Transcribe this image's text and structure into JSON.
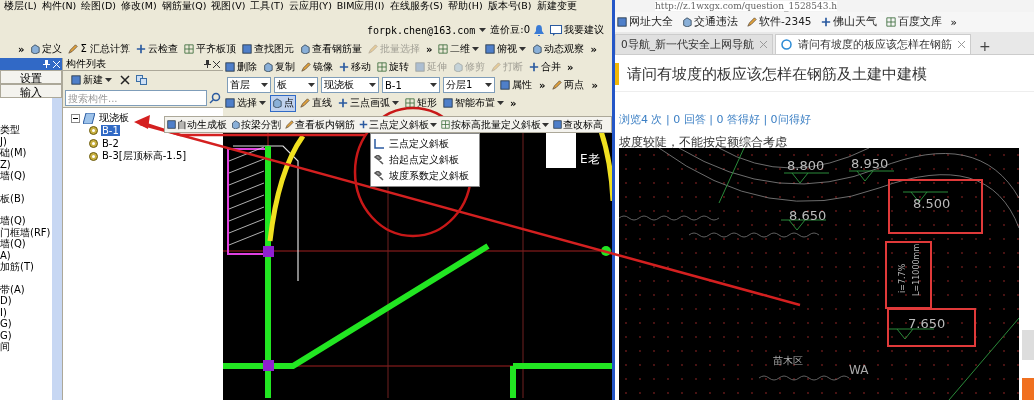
{
  "cad_app": {
    "menu": [
      "楼层(L)",
      "构件(N)",
      "绘图(D)",
      "修改(M)",
      "钢筋量(Q)",
      "视图(V)",
      "工具(T)",
      "云应用(Y)",
      "BIM应用(I)",
      "在线服务(S)",
      "帮助(H)",
      "版本号(B)",
      "新建变更"
    ],
    "account": {
      "email": "forpk.chen@163.com",
      "beans": "造价豆:0",
      "suggest": "我要建议"
    },
    "main_toolbar": [
      {
        "kind": "more",
        "label": "»"
      },
      {
        "kind": "button",
        "label": "定义",
        "disabled": false
      },
      {
        "kind": "button",
        "glyph": "Σ",
        "label": "汇总计算",
        "disabled": false
      },
      {
        "kind": "button",
        "label": "云检查",
        "disabled": false
      },
      {
        "kind": "button",
        "label": "平齐板顶",
        "disabled": false
      },
      {
        "kind": "button",
        "label": "查找图元",
        "disabled": false
      },
      {
        "kind": "button",
        "label": "查看钢筋量",
        "disabled": false
      },
      {
        "kind": "button",
        "label": "批量选择",
        "disabled": true
      },
      {
        "kind": "more",
        "label": "»"
      },
      {
        "kind": "dropdown",
        "label": "二维",
        "disabled": false
      },
      {
        "kind": "dropdown",
        "label": "俯视",
        "disabled": false
      },
      {
        "kind": "button",
        "label": "动态观察",
        "disabled": false
      },
      {
        "kind": "more",
        "label": "»"
      }
    ],
    "nav_panel": {
      "items": [
        "设置",
        "输入"
      ],
      "groups": [
        [
          "类型",
          "J)",
          "础(M)",
          "Z)",
          "墙(Q)"
        ],
        [
          "板(B)"
        ],
        [
          "墙(Q)",
          "门框墙(RF)",
          "墙(Q)",
          "A)",
          "加筋(T)"
        ],
        [
          "带(A)",
          "D)",
          "I)",
          "G)",
          "G)",
          "间"
        ]
      ]
    },
    "component_list": {
      "title": "构件列表",
      "new_button": "新建",
      "search_placeholder": "搜索构件...",
      "tree": [
        {
          "label": "现浇板",
          "expanded": true,
          "selected": false,
          "children": [
            {
              "label": "B-1",
              "selected": true
            },
            {
              "label": "B-2",
              "selected": false
            },
            {
              "label": "B-3[层顶标高-1.5]",
              "selected": false
            }
          ]
        }
      ]
    },
    "edit_toolbar": [
      {
        "kind": "button",
        "label": "删除",
        "disabled": false
      },
      {
        "kind": "button",
        "label": "复制",
        "disabled": false
      },
      {
        "kind": "button",
        "label": "镜像",
        "disabled": false
      },
      {
        "kind": "button",
        "label": "移动",
        "disabled": false
      },
      {
        "kind": "button",
        "label": "旋转",
        "disabled": false
      },
      {
        "kind": "button",
        "label": "延伸",
        "disabled": true
      },
      {
        "kind": "button",
        "label": "修剪",
        "disabled": true
      },
      {
        "kind": "button",
        "label": "打断",
        "disabled": true
      },
      {
        "kind": "button",
        "label": "合并",
        "disabled": false
      },
      {
        "kind": "more",
        "label": "»"
      }
    ],
    "selector_bar": [
      {
        "kind": "combo",
        "label": "首层"
      },
      {
        "kind": "combo",
        "label": "板"
      },
      {
        "kind": "combo",
        "label": "现浇板"
      },
      {
        "kind": "combo",
        "label": "B-1"
      },
      {
        "kind": "combo",
        "label": "分层1"
      },
      {
        "kind": "button",
        "label": "属性"
      },
      {
        "kind": "more",
        "label": "»"
      },
      {
        "kind": "button",
        "label": "两点"
      },
      {
        "kind": "more",
        "label": "»"
      }
    ],
    "draw_toolbar": [
      {
        "kind": "dropdown",
        "label": "选择",
        "pressed": false
      },
      {
        "kind": "button",
        "label": "点",
        "pressed": true
      },
      {
        "kind": "button",
        "label": "直线",
        "pressed": false
      },
      {
        "kind": "dropdown",
        "label": "三点画弧",
        "pressed": false
      },
      {
        "kind": "button",
        "label": "矩形",
        "pressed": false
      },
      {
        "kind": "dropdown",
        "label": "智能布置",
        "pressed": false
      },
      {
        "kind": "more",
        "label": "»"
      }
    ],
    "slab_toolbar": [
      {
        "kind": "button",
        "label": "自动生成板"
      },
      {
        "kind": "button",
        "label": "按梁分割"
      },
      {
        "kind": "button",
        "label": "查看板内钢筋"
      },
      {
        "kind": "dropdown",
        "label": "三点定义斜板"
      },
      {
        "kind": "dropdown",
        "label": "按标高批量定义斜板"
      },
      {
        "kind": "button",
        "label": "查改标高"
      }
    ],
    "slope_menu": [
      "三点定义斜板",
      "抬起点定义斜板",
      "坡度系数定义斜板"
    ],
    "canvas": {
      "label": "E老"
    }
  },
  "browser": {
    "address": "http://z.1wxgx.com/question_1528543.h",
    "bookmarks": [
      "网址大全",
      "交通违法",
      "软件-2345",
      "佛山天气",
      "百度文库"
    ],
    "bookmarks_more": "»",
    "tabs": [
      {
        "label": "0导航_新一代安全上网导航",
        "selected": false
      },
      {
        "label": "请问有坡度的板应该怎样在钢筋",
        "selected": true
      }
    ],
    "new_tab": "+",
    "question": {
      "title": "请问有坡度的板应该怎样在钢筋及土建中建模",
      "stats": "浏览4 次 | 0 回答 | 0 答得好 | 0问得好",
      "body": "坡度较陡，不能按定额综合考虑"
    },
    "image_labels": [
      {
        "kind": "elevation",
        "text": "8.800"
      },
      {
        "kind": "elevation",
        "text": "8.950"
      },
      {
        "kind": "elevation",
        "text": "8.650"
      },
      {
        "kind": "elevation",
        "text": "8.500"
      },
      {
        "kind": "slope",
        "text": "i=7.7%"
      },
      {
        "kind": "length",
        "text": "L=11000mm"
      },
      {
        "kind": "elevation",
        "text": "7.650"
      },
      {
        "kind": "area",
        "text": "苗木区"
      },
      {
        "kind": "area",
        "text": "WA"
      }
    ]
  }
}
